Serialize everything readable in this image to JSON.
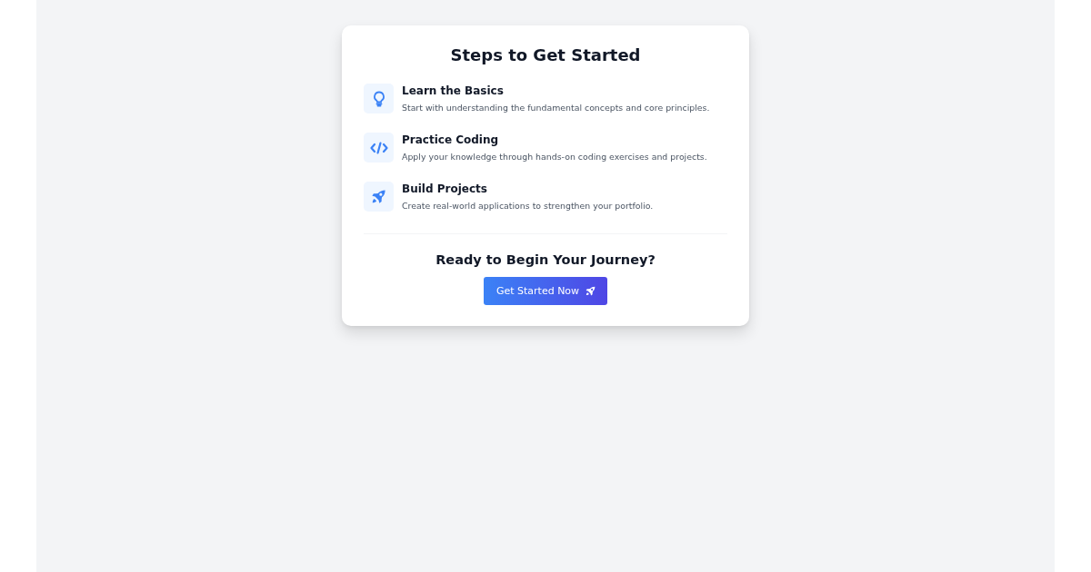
{
  "title": "Steps to Get Started",
  "steps": [
    {
      "kind": "bulb",
      "title": "Learn the Basics",
      "description": "Start with understanding the fundamental concepts and core principles."
    },
    {
      "kind": "code",
      "title": "Practice Coding",
      "description": "Apply your knowledge through hands-on coding exercises and projects."
    },
    {
      "kind": "rocket",
      "title": "Build Projects",
      "description": "Create real-world applications to strengthen your portfolio."
    }
  ],
  "cta": {
    "heading": "Ready to Begin Your Journey?",
    "button": "Get Started Now"
  }
}
